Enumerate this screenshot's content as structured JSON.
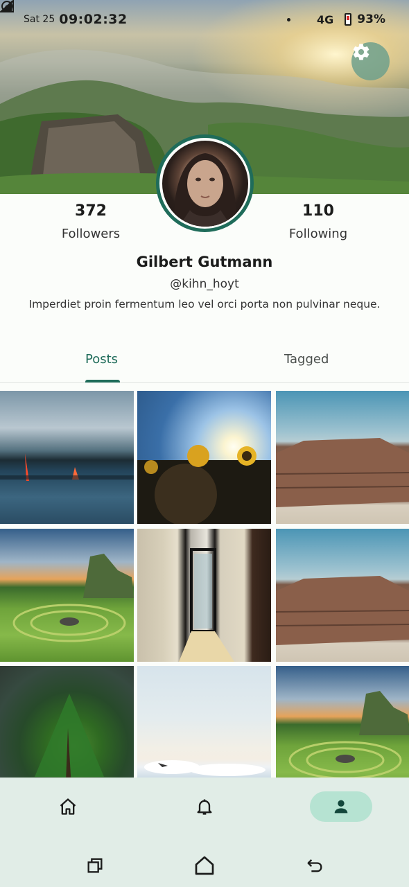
{
  "status_bar": {
    "date": "Sat 25",
    "time": "09:02:32",
    "network": "4G",
    "battery": "93%"
  },
  "profile": {
    "followers_count": "372",
    "followers_label": "Followers",
    "following_count": "110",
    "following_label": "Following",
    "name": "Gilbert Gutmann",
    "handle": "@kihn_hoyt",
    "bio": "Imperdiet proin fermentum leo vel orci porta non pulvinar neque."
  },
  "tabs": [
    {
      "label": "Posts",
      "selected": true
    },
    {
      "label": "Tagged",
      "selected": false
    }
  ],
  "posts": [
    "lava-sea-photo",
    "sunflowers-photo",
    "brick-ruins-photo",
    "fairy-circle-photo",
    "doorway-photo",
    "brick-ruins-photo",
    "pine-tree-photo",
    "clouds-photo",
    "fairy-circle-photo"
  ],
  "bottom_nav": [
    {
      "icon": "home-icon",
      "selected": false
    },
    {
      "icon": "bell-icon",
      "selected": false
    },
    {
      "icon": "person-icon",
      "selected": true
    }
  ],
  "colors": {
    "accent": "#1f6c5a",
    "nav_background": "#e1ede7",
    "nav_selected": "#b6e3d2"
  }
}
